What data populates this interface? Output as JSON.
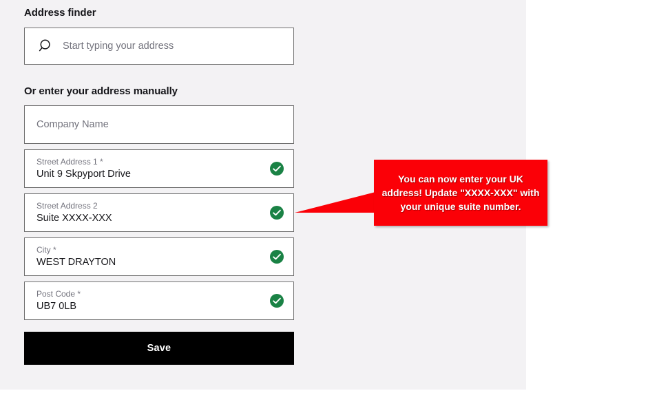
{
  "panel": {
    "background_color": "#f3f2f4",
    "page_background_color": "#ffffff"
  },
  "finder": {
    "heading": "Address finder",
    "search_icon": "search-icon",
    "search_placeholder": "Start typing your address",
    "search_value": ""
  },
  "manual": {
    "heading": "Or enter your address manually",
    "fields": [
      {
        "name": "company-name",
        "label": "",
        "placeholder": "Company Name",
        "value": "",
        "valid": false
      },
      {
        "name": "street-address-1",
        "label": "Street Address 1 *",
        "placeholder": "",
        "value": "Unit 9 Skpyport Drive",
        "valid": true
      },
      {
        "name": "street-address-2",
        "label": "Street Address 2",
        "placeholder": "",
        "value": "Suite XXXX-XXX",
        "valid": true
      },
      {
        "name": "city",
        "label": "City *",
        "placeholder": "",
        "value": "WEST DRAYTON",
        "valid": true
      },
      {
        "name": "post-code",
        "label": "Post Code *",
        "placeholder": "",
        "value": "UB7 0LB",
        "valid": true
      }
    ],
    "valid_icon": "check-circle-icon",
    "valid_icon_color": "#1a8245"
  },
  "actions": {
    "save_label": "Save",
    "save_background_color": "#000000"
  },
  "callout": {
    "text": "You can now enter your UK address! Update \"XXXX-XXX\" with your unique suite number.",
    "color": "#fb0007",
    "text_color": "#ffffff",
    "arrow_direction": "left",
    "points_at": "street-address-2"
  }
}
